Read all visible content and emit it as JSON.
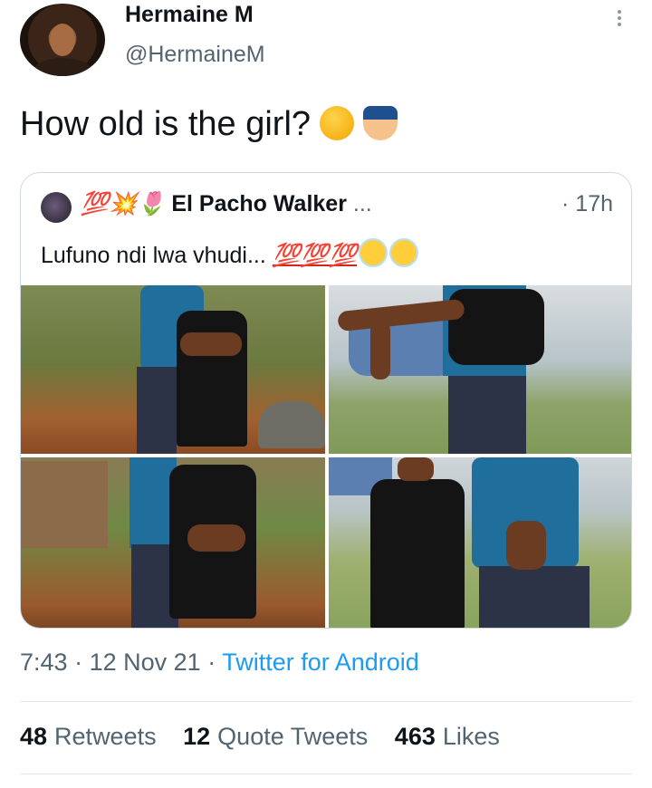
{
  "author": {
    "name": "Hermaine M",
    "handle": "@HermaineM"
  },
  "tweet": {
    "text": "How old is the girl?",
    "emojis": [
      "thinking-face-icon",
      "police-officer-icon"
    ]
  },
  "quoted": {
    "name": "El Pacho Walker",
    "name_prefix": "💯💥🌷",
    "name_suffix": "...",
    "time": "· 17h",
    "text": "Lufuno ndi lwa vhudi...",
    "text_suffix": "💯💯💯"
  },
  "meta": {
    "time": "7:43",
    "date": "12 Nov 21",
    "source": "Twitter for Android",
    "sep": "·"
  },
  "stats": {
    "retweets_count": "48",
    "retweets_label": "Retweets",
    "quotes_count": "12",
    "quotes_label": "Quote Tweets",
    "likes_count": "463",
    "likes_label": "Likes"
  },
  "colors": {
    "link": "#1d9bf0",
    "muted": "#536471",
    "border": "#cfd9de"
  }
}
